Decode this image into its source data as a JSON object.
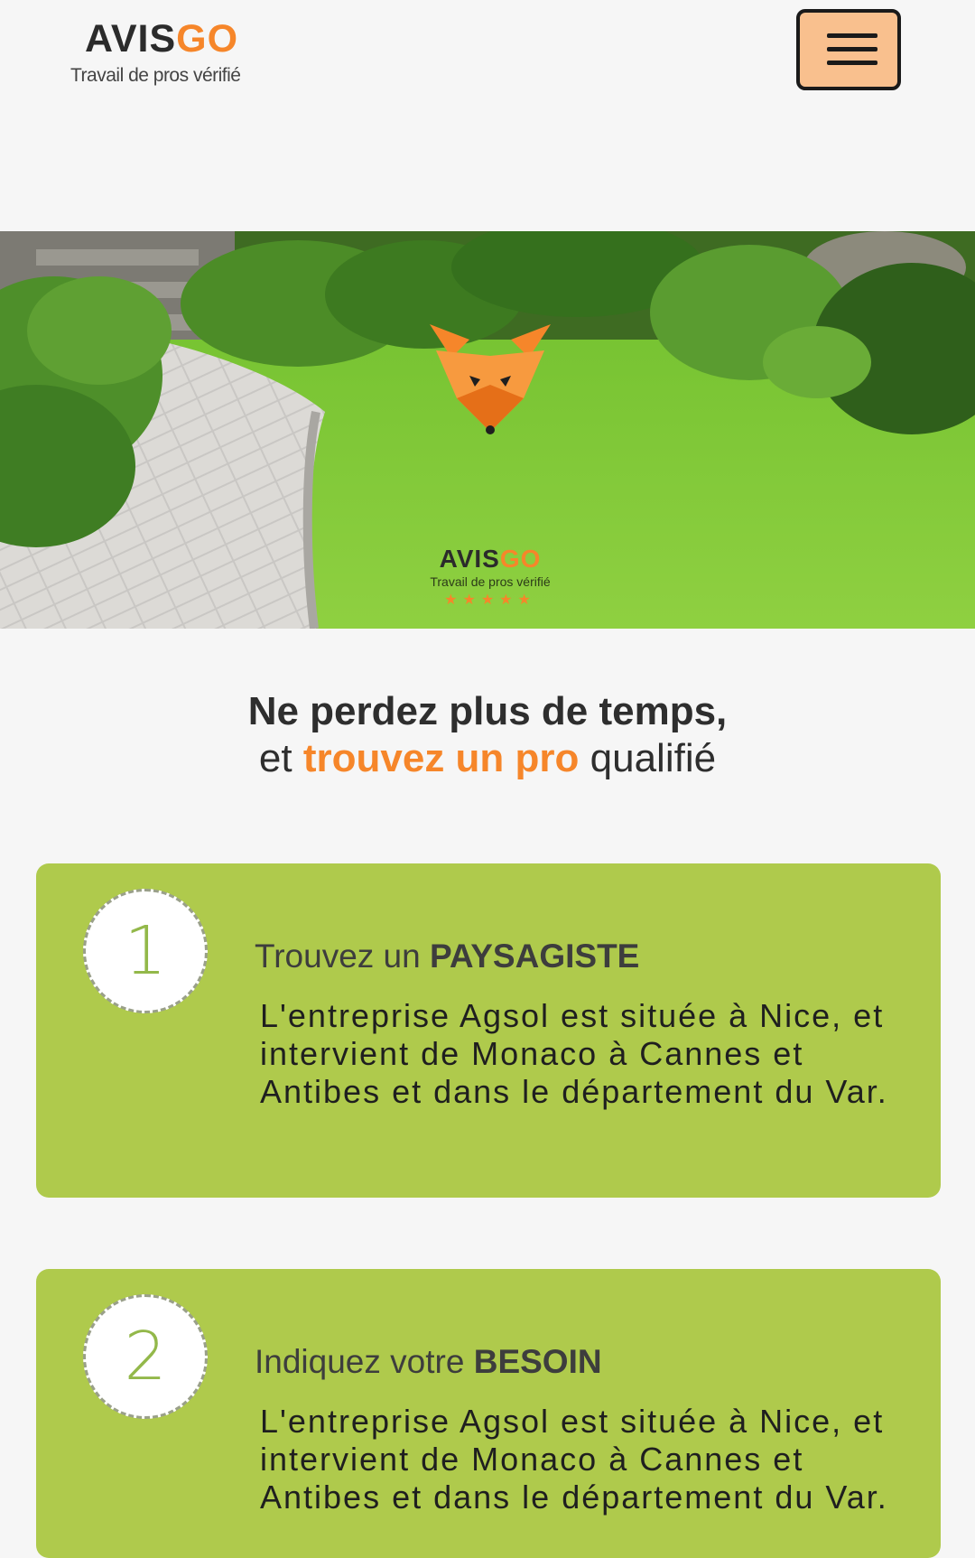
{
  "header": {
    "logo": {
      "word_part1": "AVIS",
      "word_part2": "GO",
      "tagline": "Travail de pros vérifié"
    },
    "menu_icon": "hamburger-icon"
  },
  "hero": {
    "icon": "fox-icon",
    "logo": {
      "word_part1": "AVIS",
      "word_part2": "GO",
      "tagline": "Travail de pros vérifié",
      "stars": "★★★★★"
    }
  },
  "headline": {
    "line1": "Ne perdez plus de temps,",
    "line2_prefix": "et",
    "line2_highlight": "trouvez un pro",
    "line2_suffix": "qualifié"
  },
  "steps": [
    {
      "number": "1",
      "title_prefix": "Trouvez un",
      "title_bold": "PAYSAGISTE",
      "description": "L'entreprise Agsol est située à Nice, et intervient de Monaco à Cannes et Antibes et dans le département du Var."
    },
    {
      "number": "2",
      "title_prefix": "Indiquez votre",
      "title_bold": "BESOIN",
      "description": "L'entreprise Agsol est située à Nice, et intervient de Monaco à Cannes et Antibes et dans le département du Var."
    }
  ],
  "colors": {
    "accent_orange": "#f6862a",
    "card_green": "#afca4c",
    "menu_button": "#f9c08e",
    "background": "#f6f6f6"
  }
}
